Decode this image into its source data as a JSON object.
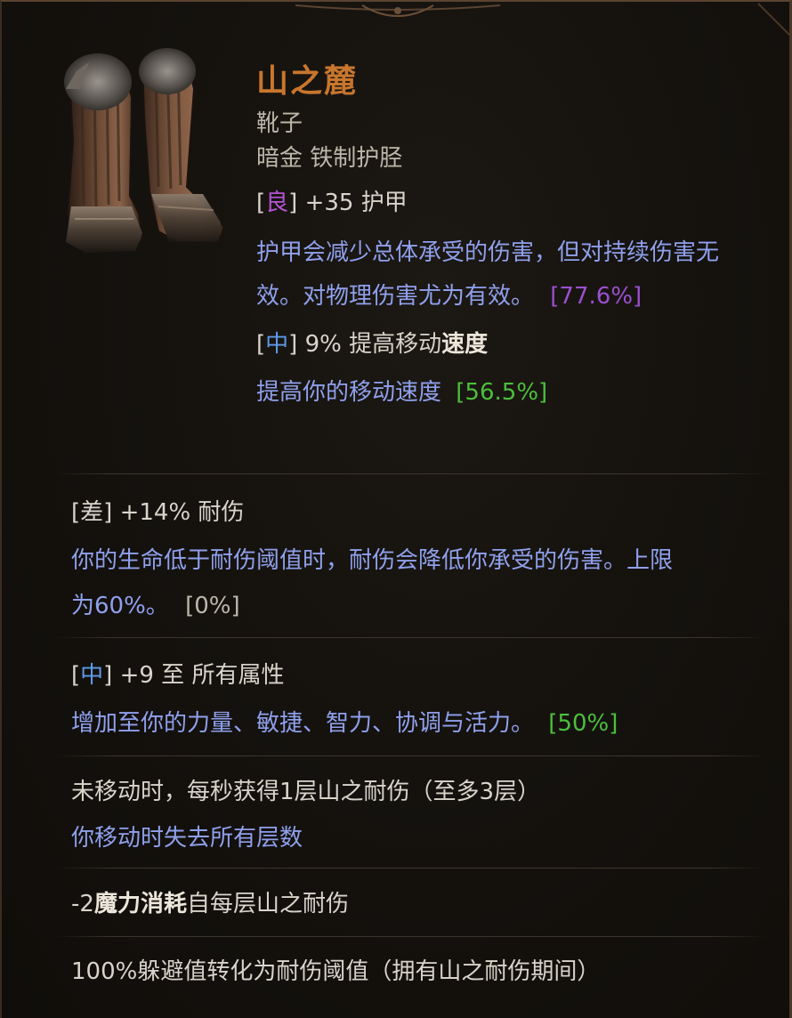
{
  "item": {
    "name": "山之麓",
    "type": "靴子",
    "rarity": "暗金 铁制护胫",
    "image_icon": "boots-icon"
  },
  "base_stats": [
    {
      "tier": "良",
      "stat": "+35 护甲",
      "desc_line1": "护甲会减少总体承受的伤害，但对持续伤害无",
      "desc_line2": "效。对物理伤害尤为有效。",
      "pct": "[77.6%]"
    },
    {
      "tier": "中",
      "stat_prefix": "9% 提高移动",
      "stat_bold": "速度",
      "desc": "提高你的移动速度",
      "pct": "[56.5%]"
    }
  ],
  "affixes": [
    {
      "tier": "差",
      "stat": "+14% 耐伤",
      "desc_line1": "你的生命低于耐伤阈值时，耐伤会降低你承受的伤害。上限",
      "desc_line2": "为60%。",
      "pct": "[0%]"
    },
    {
      "tier": "中",
      "stat": "+9 至 所有属性",
      "desc": "增加至你的力量、敏捷、智力、协调与活力。",
      "pct": "[50%]"
    }
  ],
  "uniques": [
    {
      "line1": "未移动时，每秒获得1层山之耐伤（至多3层）",
      "line2": "你移动时失去所有层数"
    },
    {
      "prefix": "-2",
      "bold": "魔力消耗",
      "suffix": "自每层山之耐伤"
    },
    {
      "line1": "100%躲避值转化为耐伤阈值（拥有山之耐伤期间）"
    }
  ],
  "colors": {
    "name": "#c8762e",
    "desc": "#8fa0ec",
    "tier_good": "#b455d4",
    "tier_mid": "#5e9ae6",
    "pct_purple": "#9b4fd0",
    "pct_green": "#4cbf3c"
  }
}
